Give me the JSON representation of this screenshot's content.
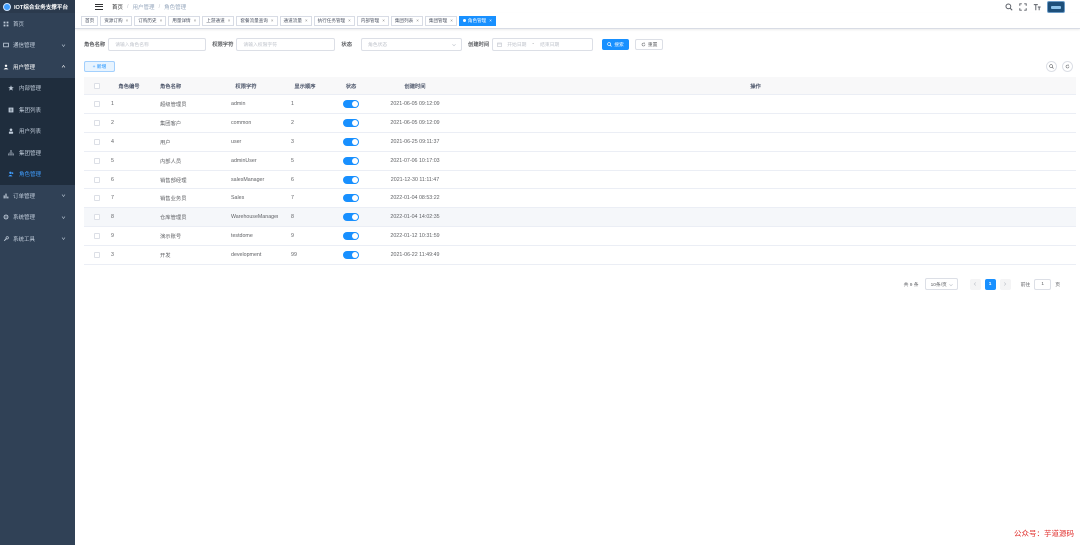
{
  "sidebar": {
    "logo_text": "IOT综合业务支撑平台",
    "menu": [
      {
        "label": "首页"
      },
      {
        "label": "通信管理"
      },
      {
        "label": "用户管理"
      }
    ],
    "sub_items": [
      {
        "label": "内部管理"
      },
      {
        "label": "集团列表"
      },
      {
        "label": "用户列表"
      },
      {
        "label": "集团管理"
      },
      {
        "label": "角色管理"
      }
    ],
    "menu_bottom": [
      {
        "label": "订单管理"
      },
      {
        "label": "系统管理"
      },
      {
        "label": "系统工具"
      }
    ]
  },
  "breadcrumb": [
    "首页",
    "用户管理",
    "角色管理"
  ],
  "tags": [
    "首页",
    "资源订购",
    "订购历史",
    "用量详情",
    "上游通道",
    "套餐流量查询",
    "通道流量",
    "执行任务管理",
    "内部管理",
    "集团列表",
    "集团管理",
    "角色管理"
  ],
  "search": {
    "role_name_label": "角色名称",
    "role_name_placeholder": "请输入角色名称",
    "role_key_label": "权限字符",
    "role_key_placeholder": "请输入权限字符",
    "status_label": "状态",
    "status_placeholder": "角色状态",
    "date_label": "创建时间",
    "date_start": "开始日期",
    "date_sep": "-",
    "date_end": "结束日期",
    "search_btn": "搜索",
    "reset_btn": "重置"
  },
  "toolbar": {
    "add_label": "+ 新增"
  },
  "table": {
    "headers": {
      "id": "角色编号",
      "name": "角色名称",
      "key": "权限字符",
      "sort": "显示顺序",
      "status": "状态",
      "time": "创建时间",
      "ops": "操作"
    },
    "rows": [
      {
        "id": "1",
        "name": "超级管理员",
        "key": "admin",
        "sort": "1",
        "enabled": true,
        "time": "2021-06-05 09:12:09"
      },
      {
        "id": "2",
        "name": "集团客户",
        "key": "common",
        "sort": "2",
        "enabled": true,
        "time": "2021-06-05 09:12:09"
      },
      {
        "id": "4",
        "name": "用户",
        "key": "user",
        "sort": "3",
        "enabled": true,
        "time": "2021-06-25 09:11:37"
      },
      {
        "id": "5",
        "name": "内部人员",
        "key": "adminUser",
        "sort": "5",
        "enabled": true,
        "time": "2021-07-06 10:17:03"
      },
      {
        "id": "6",
        "name": "销售部经理",
        "key": "salesManager",
        "sort": "6",
        "enabled": true,
        "time": "2021-12-30 11:11:47"
      },
      {
        "id": "7",
        "name": "销售业务员",
        "key": "Sales",
        "sort": "7",
        "enabled": true,
        "time": "2022-01-04 08:53:22"
      },
      {
        "id": "8",
        "name": "仓库管理员",
        "key": "WarehouseManager",
        "sort": "8",
        "enabled": true,
        "time": "2022-01-04 14:02:35"
      },
      {
        "id": "9",
        "name": "演示账号",
        "key": "testdome",
        "sort": "9",
        "enabled": true,
        "time": "2022-01-12 10:31:59"
      },
      {
        "id": "3",
        "name": "开发",
        "key": "development",
        "sort": "99",
        "enabled": true,
        "time": "2021-06-22 11:49:49"
      }
    ]
  },
  "pagination": {
    "total_text": "共 9 条",
    "page_size": "10条/页",
    "current_page": "1",
    "goto_label": "前往",
    "goto_value": "1",
    "page_unit": "页"
  },
  "watermark": "公众号：芋道源码",
  "colors": {
    "sidebar_bg": "#304156",
    "accent": "#1890ff",
    "active_menu": "#409eff"
  }
}
